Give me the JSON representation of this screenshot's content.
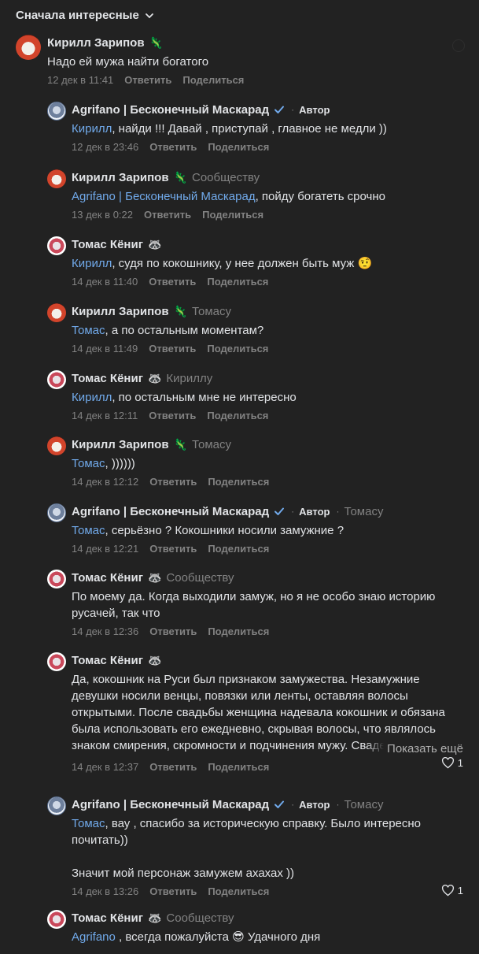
{
  "sort": {
    "label": "Сначала интересные"
  },
  "actions": {
    "reply": "Ответить",
    "share": "Поделиться",
    "show_more": "Показать ещё"
  },
  "role_author": "Автор",
  "comments": [
    {
      "author": "Кирилл Зарипов",
      "badge": "🦎",
      "mention": "",
      "text": "Надо ей мужа найти богатого",
      "date": "12 дек в 11:41"
    },
    {
      "author": "Agrifano | Бесконечный Маскарад",
      "badge": "",
      "mention": "Кирилл",
      "text": ", найди !!! Давай , приступай , главное не медли ))",
      "date": "12 дек в 23:46"
    },
    {
      "author": "Кирилл Зарипов",
      "badge": "🦎",
      "reply_to": "Сообществу",
      "mention": "Agrifano | Бесконечный Маскарад",
      "text": ", пойду богатеть срочно",
      "date": "13 дек в 0:22"
    },
    {
      "author": "Томас Кёниг",
      "badge": "🦝",
      "mention": "Кирилл",
      "text": ", судя по кокошнику, у нее должен быть муж 🤨",
      "date": "14 дек в 11:40"
    },
    {
      "author": "Кирилл Зарипов",
      "badge": "🦎",
      "reply_to": "Томасу",
      "mention": "Томас",
      "text": ", а по остальным моментам?",
      "date": "14 дек в 11:49"
    },
    {
      "author": "Томас Кёниг",
      "badge": "🦝",
      "reply_to": "Кириллу",
      "mention": "Кирилл",
      "text": ", по остальным мне не интересно",
      "date": "14 дек в 12:11"
    },
    {
      "author": "Кирилл Зарипов",
      "badge": "🦎",
      "reply_to": "Томасу",
      "mention": "Томас",
      "text": ", ))))))",
      "date": "14 дек в 12:12"
    },
    {
      "author": "Agrifano | Бесконечный Маскарад",
      "badge": "",
      "reply_to": "Томасу",
      "mention": "Томас",
      "text": ", серьёзно ? Кокошники носили замужние ?",
      "date": "14 дек в 12:21"
    },
    {
      "author": "Томас Кёниг",
      "badge": "🦝",
      "reply_to": "Сообществу",
      "mention": "",
      "text": "По моему да. Когда выходили замуж, но я не особо знаю историю русачей, так что",
      "date": "14 дек в 12:36"
    },
    {
      "author": "Томас Кёниг",
      "badge": "🦝",
      "mention": "",
      "text": "Да, кокошник на Руси был признаком замужества. Незамужние девушки носили венцы, повязки или ленты, оставляя волосы открытыми. После свадьбы женщина надевала кокошник и обязана была использовать его ежедневно, скрывая волосы, что являлось знаком смирения, скромности и подчинения мужу. Свадебный кокошник часто украшали речным жемчугом",
      "date": "14 дек в 12:37",
      "likes": "1"
    },
    {
      "author": "Agrifano | Бесконечный Маскарад",
      "badge": "",
      "reply_to": "Томасу",
      "mention": "Томас",
      "text": ", вау , спасибо за историческую справку. Было интересно почитать))",
      "text2": "Значит мой персонаж замужем ахахах ))",
      "date": "14 дек в 13:26",
      "likes": "1"
    },
    {
      "author": "Томас Кёниг",
      "badge": "🦝",
      "reply_to": "Сообществу",
      "mention": "Agrifano",
      "text": " , всегда пожалуйста 😎 Удачного дня",
      "date": ""
    }
  ]
}
